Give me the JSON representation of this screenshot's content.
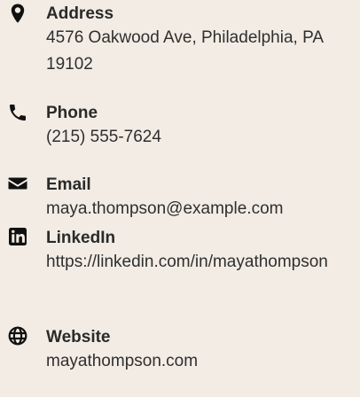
{
  "contact": {
    "address": {
      "label": "Address",
      "value": "4576 Oakwood Ave, Philadelphia, PA 19102",
      "icon": "map-pin-icon"
    },
    "phone": {
      "label": "Phone",
      "value": "(215) 555-7624",
      "icon": "phone-icon"
    },
    "email": {
      "label": "Email",
      "value": "maya.thompson@example.com",
      "icon": "envelope-icon"
    },
    "linkedin": {
      "label": "LinkedIn",
      "value": "https://linkedin.com/in/mayathompson",
      "icon": "linkedin-icon"
    },
    "website": {
      "label": "Website",
      "value": "mayathompson.com",
      "icon": "globe-icon"
    }
  }
}
